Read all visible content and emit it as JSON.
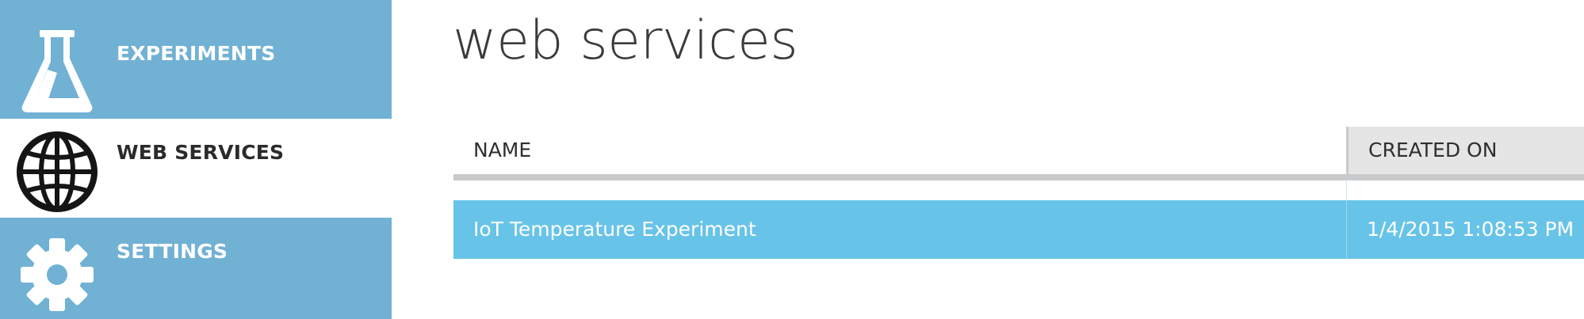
{
  "sidebar": {
    "items": [
      {
        "label": "EXPERIMENTS",
        "icon": "flask-icon",
        "state": "inactive"
      },
      {
        "label": "WEB SERVICES",
        "icon": "globe-icon",
        "state": "active"
      },
      {
        "label": "SETTINGS",
        "icon": "gear-icon",
        "state": "inactive"
      }
    ]
  },
  "main": {
    "title": "web services",
    "table": {
      "columns": [
        "NAME",
        "CREATED ON"
      ],
      "rows": [
        {
          "name": "IoT Temperature Experiment",
          "created_on": "1/4/2015 1:08:53 PM",
          "selected": true
        }
      ]
    }
  },
  "colors": {
    "sidebar_blue": "#71b1d4",
    "row_selected": "#68c3e8",
    "header_border": "#c8cacc",
    "header_sorted_bg": "#e5e5e5"
  }
}
